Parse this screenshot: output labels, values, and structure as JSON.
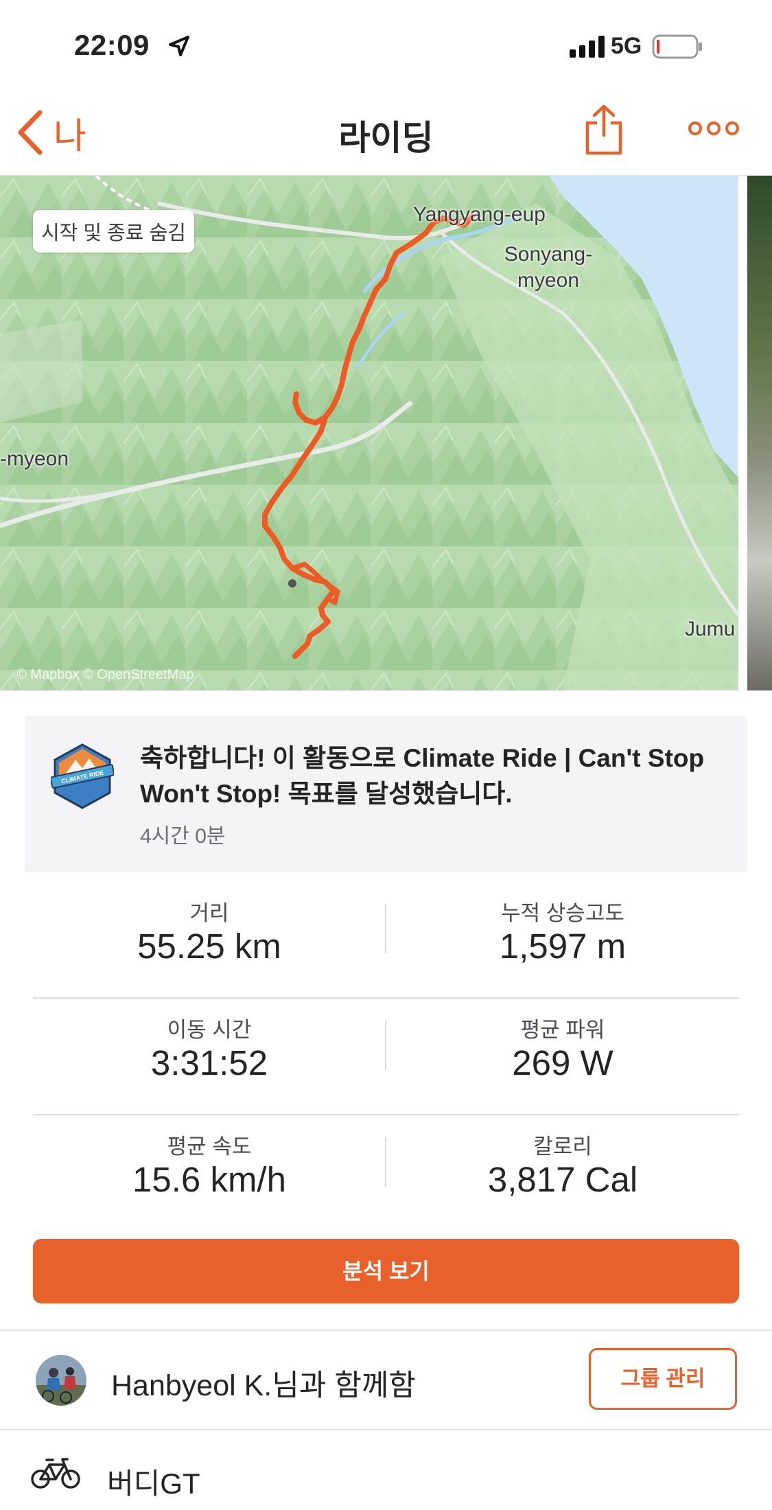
{
  "status_bar": {
    "time": "22:09",
    "network": "5G"
  },
  "nav": {
    "back_label": "나",
    "title": "라이딩"
  },
  "map": {
    "toggle_label": "시작 및 종료 숨김",
    "place_labels": [
      "Yangyang-eup",
      "Sonyang-\nmyeon",
      "-myeon",
      "Jumu"
    ],
    "attribution": "© Mapbox © OpenStreetMap",
    "route_color": "#ee5a24"
  },
  "achievement": {
    "message": "축하합니다! 이 활동으로 Climate Ride | Can't Stop Won't Stop! 목표를 달성했습니다.",
    "time_ago": "4시간 0분",
    "badge_text": "CLIMATE RIDE"
  },
  "stats": [
    {
      "label": "거리",
      "value": "55.25 km"
    },
    {
      "label": "누적 상승고도",
      "value": "1,597 m"
    },
    {
      "label": "이동 시간",
      "value": "3:31:52"
    },
    {
      "label": "평균 파워",
      "value": "269 W"
    },
    {
      "label": "평균 속도",
      "value": "15.6 km/h"
    },
    {
      "label": "칼로리",
      "value": "3,817 Cal"
    }
  ],
  "analysis_button": "분석 보기",
  "with": {
    "text": "Hanbyeol K.님과 함께함",
    "button": "그룹 관리"
  },
  "gear": {
    "name": "버디GT"
  },
  "colors": {
    "accent": "#e8602a",
    "map_green": "#b9dcb0",
    "water": "#cde6f7"
  }
}
